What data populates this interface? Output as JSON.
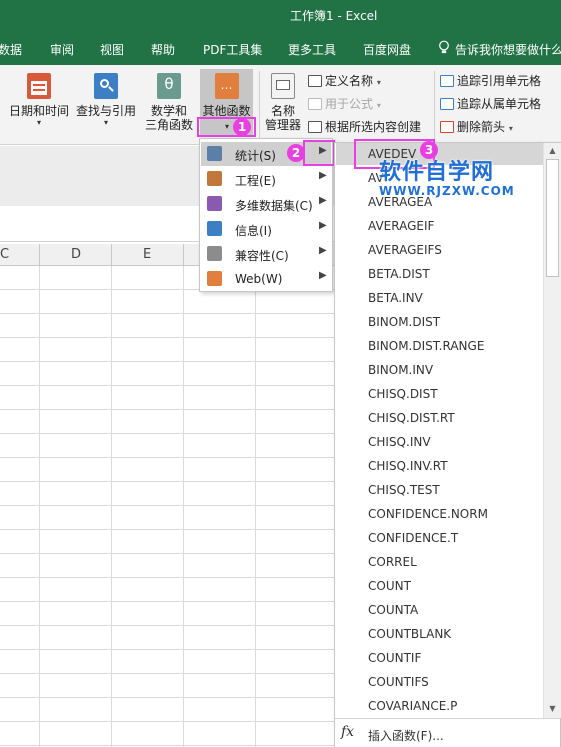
{
  "window": {
    "title": "工作簿1  -  Excel"
  },
  "menubar": {
    "items": [
      "数据",
      "审阅",
      "视图",
      "帮助",
      "PDF工具集",
      "更多工具",
      "百度网盘"
    ],
    "tellme": "告诉我你想要做什么"
  },
  "ribbon": {
    "datetime": {
      "label": "日期和时间"
    },
    "lookup": {
      "label": "查找与引用"
    },
    "math": {
      "line1": "数学和",
      "line2": "三角函数"
    },
    "other": {
      "label": "其他函数"
    },
    "names": {
      "line1": "名称",
      "line2": "管理器"
    },
    "define_name": "定义名称",
    "use_in_formula": "用于公式",
    "create_from_selection": "根据所选内容创建",
    "trace_precedents": "追踪引用单元格",
    "trace_dependents": "追踪从属单元格",
    "remove_arrows": "删除箭头",
    "caret": "▾"
  },
  "sheet": {
    "columns": [
      "C",
      "D",
      "E"
    ]
  },
  "category_menu": {
    "items": [
      {
        "label": "统计(S)",
        "icon": "chart-icon"
      },
      {
        "label": "工程(E)",
        "icon": "engineering-icon"
      },
      {
        "label": "多维数据集(C)",
        "icon": "cube-icon"
      },
      {
        "label": "信息(I)",
        "icon": "info-icon"
      },
      {
        "label": "兼容性(C)",
        "icon": "compat-icon"
      },
      {
        "label": "Web(W)",
        "icon": "web-icon"
      }
    ],
    "arrow": "▶"
  },
  "function_list": {
    "items": [
      "AVEDEV",
      "AV",
      "AVERAGEA",
      "AVERAGEIF",
      "AVERAGEIFS",
      "BETA.DIST",
      "BETA.INV",
      "BINOM.DIST",
      "BINOM.DIST.RANGE",
      "BINOM.INV",
      "CHISQ.DIST",
      "CHISQ.DIST.RT",
      "CHISQ.INV",
      "CHISQ.INV.RT",
      "CHISQ.TEST",
      "CONFIDENCE.NORM",
      "CONFIDENCE.T",
      "CORREL",
      "COUNT",
      "COUNTA",
      "COUNTBLANK",
      "COUNTIF",
      "COUNTIFS",
      "COVARIANCE.P"
    ],
    "footer": {
      "fx": "fx",
      "label": "插入函数(F)..."
    },
    "scroll_up": "▲",
    "scroll_down": "▼"
  },
  "annotations": {
    "badges": [
      "1",
      "2",
      "3"
    ]
  },
  "watermark": {
    "line1": "软件自学网",
    "line2": "WWW.RJZXW.COM"
  },
  "colors": {
    "excel_green": "#217346",
    "annotation_magenta": "#e83fe3",
    "watermark_blue": "#1f6fd6"
  }
}
